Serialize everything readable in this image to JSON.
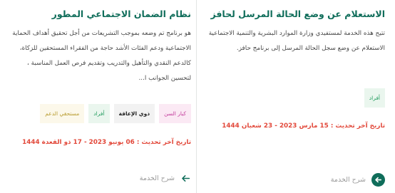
{
  "cards": [
    {
      "title": "الاستعلام عن وضع الحالة المرسل لحافز",
      "description": "تتيح هذه الخدمة لمستفيدي وزارة الموارد البشرية والتنمية الاجتماعية الاستعلام عن وضع سجل الحالة المرسل إلى برنامج حافز.",
      "tags": [
        "أفراد"
      ],
      "updated": "تاريخ آخر تحديث : 15 مارس 2023 - 23 شعبان 1444",
      "link_label": "شرح الخدمة",
      "link_icon": "arrow-left-circle-icon"
    },
    {
      "title": "نظام الضمان الاجتماعي المطور",
      "description": "هو برنامج تم وضعه بموجب التشريعات من أجل تحقيق أهداف الحماية الاجتماعية ودعم الفئات الأشد حاجة من الفقراء المستحقين للزكاة، كالدعم النقدي والتأهيل والتدريب وتقديم فرص العمل المناسبة ، لتحسين الجوانب ا...",
      "tags": [
        "كبار السن",
        "ذوي الإعاقة",
        "أفراد",
        "مستحقي الدعم"
      ],
      "updated": "تاريخ آخر تحديث : 06 يونيو 2023 - 17 ذو القعدة 1444",
      "link_label": "شرح الخدمة",
      "link_icon": "arrow-left-icon"
    }
  ],
  "colors": {
    "title": "#0f6d5a",
    "date": "#e2483a",
    "tag_pink": "#c23a9b",
    "tag_green": "#1e9a5b",
    "tag_yellow": "#b79a2c"
  }
}
